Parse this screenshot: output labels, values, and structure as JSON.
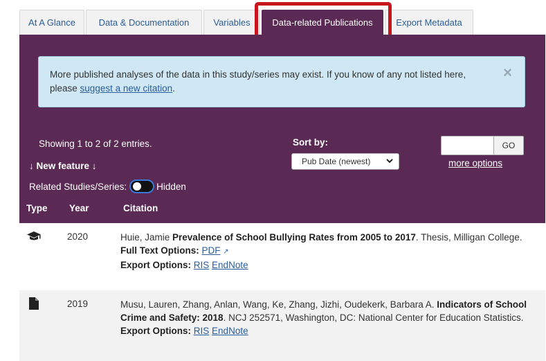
{
  "tabs": [
    {
      "label": "At A Glance",
      "active": false
    },
    {
      "label": "Data & Documentation",
      "active": false
    },
    {
      "label": "Variables",
      "active": false
    },
    {
      "label": "Data-related Publications",
      "active": true
    },
    {
      "label": "Export Metadata",
      "active": false
    }
  ],
  "notice": {
    "text_before": "More published analyses of the data in this study/series may exist. If you know of any not listed here, please ",
    "link": "suggest a new citation",
    "text_after": ".",
    "close_icon": "×"
  },
  "controls": {
    "showing": "Showing 1 to 2 of 2 entries.",
    "new_feature": "↓ New feature ↓",
    "related_label": "Related Studies/Series:",
    "related_state": "Hidden",
    "sort_label": "Sort by:",
    "sort_value": "Pub Date (newest)",
    "search_placeholder": "",
    "go_label": "GO",
    "more_options": "more options"
  },
  "table": {
    "headers": {
      "type": "Type",
      "year": "Year",
      "citation": "Citation"
    },
    "rows": [
      {
        "icon": "graduation-cap-icon",
        "year": "2020",
        "authors": "Huie, Jamie ",
        "title": "Prevalence of School Bullying Rates from 2005 to 2017",
        "rest": ". Thesis, Milligan College.",
        "full_text_label": "Full Text Options:",
        "full_text_link": "PDF",
        "export_label": "Export Options:",
        "export_link1": "RIS",
        "export_link2": "EndNote"
      },
      {
        "icon": "document-icon",
        "year": "2019",
        "authors": "Musu, Lauren, Zhang, Anlan, Wang, Ke, Zhang, Jizhi, Oudekerk, Barbara A. ",
        "title": "Indicators of School Crime and Safety: 2018",
        "rest": ". NCJ 252571, Washington, DC: National Center for Education Statistics.",
        "export_label": "Export Options:",
        "export_link1": "RIS",
        "export_link2": "EndNote"
      }
    ]
  },
  "colors": {
    "panel": "#5a2a55",
    "highlight": "#c8161d",
    "notice_bg": "#cfe8f3",
    "link": "#2a5d9a"
  }
}
